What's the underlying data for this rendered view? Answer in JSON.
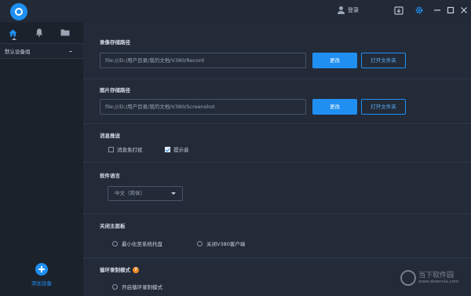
{
  "titlebar": {
    "login_label": "登录",
    "icons": [
      "user-icon",
      "download-icon",
      "settings-gear-icon",
      "minimize-icon",
      "maximize-icon",
      "close-icon"
    ],
    "accent_color": "#1f8ff2"
  },
  "sidebar": {
    "tabs": [
      "home-icon",
      "bell-icon",
      "folder-icon"
    ],
    "group_label": "默认设备组",
    "add_device_label": "添加设备"
  },
  "record": {
    "title": "录像存储路径",
    "path": "file:///D:/用户目录/我的文档/V380/Record",
    "change_label": "更改",
    "open_label": "打开文件夹"
  },
  "screenshot": {
    "title": "图片存储路径",
    "path": "file:///D:/用户目录/我的文档/V380/Screenshot",
    "change_label": "更改",
    "open_label": "打开文件夹"
  },
  "notification": {
    "title": "消息推送",
    "do_not_disturb": {
      "label": "消息免打扰",
      "checked": false
    },
    "sound": {
      "label": "提示音",
      "checked": true
    }
  },
  "language": {
    "title": "软件语言",
    "selected": "中文（简体）"
  },
  "close_panel": {
    "title": "关闭主面板",
    "options": [
      {
        "label": "最小化至系统托盘"
      },
      {
        "label": "关闭V380客户端"
      }
    ]
  },
  "loop_record": {
    "title": "循环录制模式",
    "help": "?",
    "option_label": "开启循环录制模式"
  },
  "watermark": {
    "text": "当下软件园",
    "url": "www.downxia.com"
  }
}
